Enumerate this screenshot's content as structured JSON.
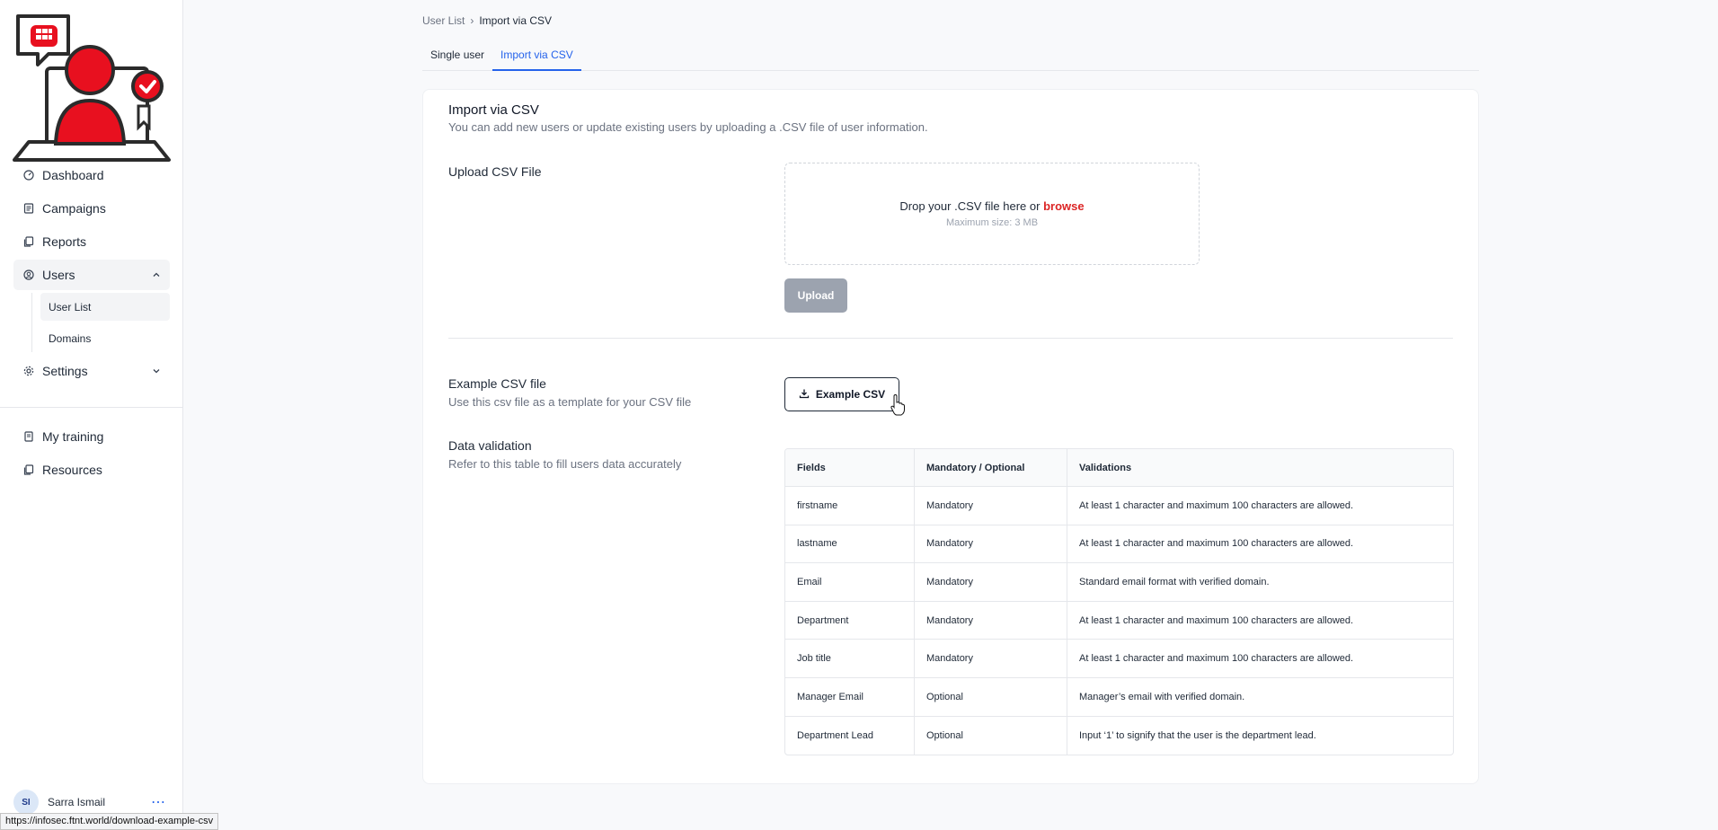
{
  "sidebar": {
    "nav": [
      {
        "label": "Dashboard",
        "icon": "dashboard-icon"
      },
      {
        "label": "Campaigns",
        "icon": "campaigns-icon"
      },
      {
        "label": "Reports",
        "icon": "reports-icon"
      },
      {
        "label": "Users",
        "icon": "users-icon"
      }
    ],
    "users_sub": [
      {
        "label": "User List"
      },
      {
        "label": "Domains"
      }
    ],
    "settings_label": "Settings",
    "nav2": [
      {
        "label": "My training",
        "icon": "training-icon"
      },
      {
        "label": "Resources",
        "icon": "resources-icon"
      }
    ],
    "user": {
      "initials": "SI",
      "name": "Sarra Ismail",
      "menu": "⋯"
    }
  },
  "status_url": "https://infosec.ftnt.world/download-example-csv",
  "breadcrumb": {
    "parent": "User List",
    "separator": "›",
    "current": "Import via CSV"
  },
  "tabs": [
    {
      "label": "Single user"
    },
    {
      "label": "Import via CSV"
    }
  ],
  "card": {
    "title": "Import via CSV",
    "subtitle": "You can add new users or update existing users by uploading a .CSV file of user information.",
    "upload_title": "Upload CSV File",
    "drop_text": "Drop your .CSV file here or",
    "browse_label": "browse",
    "max_size": "Maximum size: 3 MB",
    "upload_button": "Upload",
    "example_title": "Example CSV file",
    "example_sub": "Use this csv file as a template for your CSV file",
    "example_button": "Example CSV",
    "validation_title": "Data validation",
    "validation_sub": "Refer to this table to fill users data accurately"
  },
  "table": {
    "headers": [
      "Fields",
      "Mandatory / Optional",
      "Validations"
    ],
    "rows": [
      [
        "firstname",
        "Mandatory",
        "At least 1 character and maximum 100 characters are allowed."
      ],
      [
        "lastname",
        "Mandatory",
        "At least 1 character and maximum 100 characters are allowed."
      ],
      [
        "Email",
        "Mandatory",
        "Standard email format with verified domain."
      ],
      [
        "Department",
        "Mandatory",
        "At least 1 character and maximum 100 characters are allowed."
      ],
      [
        "Job title",
        "Mandatory",
        "At least 1 character and maximum 100 characters are allowed."
      ],
      [
        "Manager Email",
        "Optional",
        "Manager’s email with verified domain."
      ],
      [
        "Department Lead",
        "Optional",
        "Input ‘1’ to signify that the user is the department lead."
      ]
    ]
  },
  "colors": {
    "accent": "#2563eb",
    "brand_red": "#dc2626",
    "disabled": "#9ca3af"
  }
}
